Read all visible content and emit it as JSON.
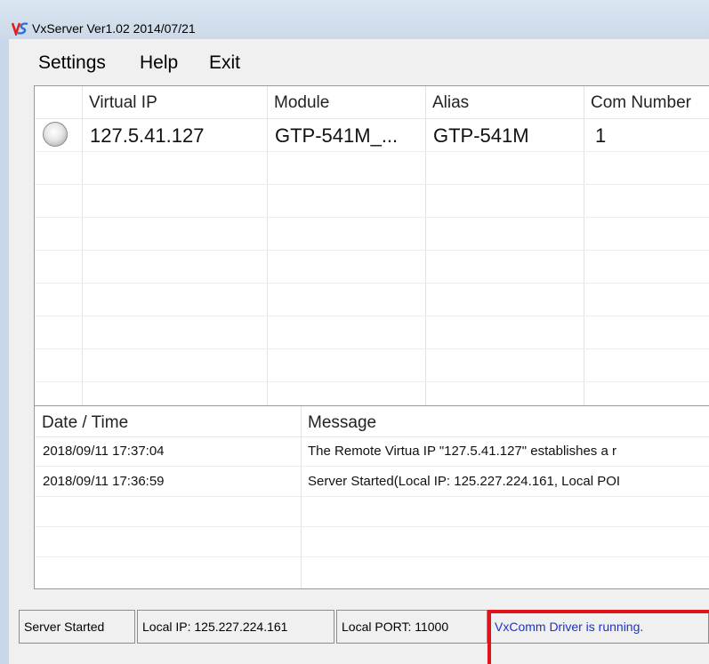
{
  "window": {
    "title": "VxServer Ver1.02 2014/07/21"
  },
  "menu": {
    "items": [
      "Settings",
      "Help",
      "Exit"
    ]
  },
  "device_table": {
    "columns": [
      "",
      "Virtual IP",
      "Module",
      "Alias",
      "Com Number"
    ],
    "rows": [
      {
        "status": "idle",
        "virtual_ip": "127.5.41.127",
        "module": "GTP-541M_...",
        "alias": "GTP-541M",
        "com": "1"
      }
    ]
  },
  "log_table": {
    "columns": [
      "Date / Time",
      "Message"
    ],
    "rows": [
      {
        "time": "2018/09/11 17:37:04",
        "message": "The Remote Virtua IP \"127.5.41.127\" establishes a r"
      },
      {
        "time": "2018/09/11 17:36:59",
        "message": "Server Started(Local IP: 125.227.224.161, Local POI"
      }
    ]
  },
  "status_bar": {
    "server_status": "Server Started",
    "local_ip": "Local IP: 125.227.224.161",
    "local_port": "Local PORT: 11000",
    "driver_status": "VxComm Driver is running.",
    "driver_status_color": "#1a33cc",
    "highlight_color": "#e3111a"
  }
}
